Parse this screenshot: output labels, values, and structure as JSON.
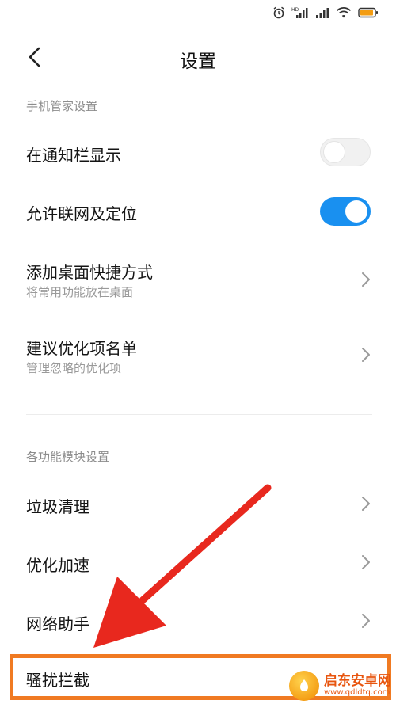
{
  "header": {
    "title": "设置"
  },
  "sections": {
    "phone_manager": "手机管家设置",
    "modules": "各功能模块设置"
  },
  "rows": {
    "notify": {
      "title": "在通知栏显示",
      "enabled": false
    },
    "network": {
      "title": "允许联网及定位",
      "enabled": true
    },
    "shortcut": {
      "title": "添加桌面快捷方式",
      "subtitle": "将常用功能放在桌面"
    },
    "optimize_list": {
      "title": "建议优化项名单",
      "subtitle": "管理忽略的优化项"
    },
    "cleanup": {
      "title": "垃圾清理"
    },
    "speedup": {
      "title": "优化加速"
    },
    "network_assistant": {
      "title": "网络助手"
    },
    "block": {
      "title": "骚扰拦截"
    }
  },
  "watermark": {
    "name": "启东安卓网",
    "url": "www.qdldtq.com"
  },
  "colors": {
    "accent": "#1990f0",
    "highlight": "#f07a22",
    "arrow": "#e8281e"
  }
}
